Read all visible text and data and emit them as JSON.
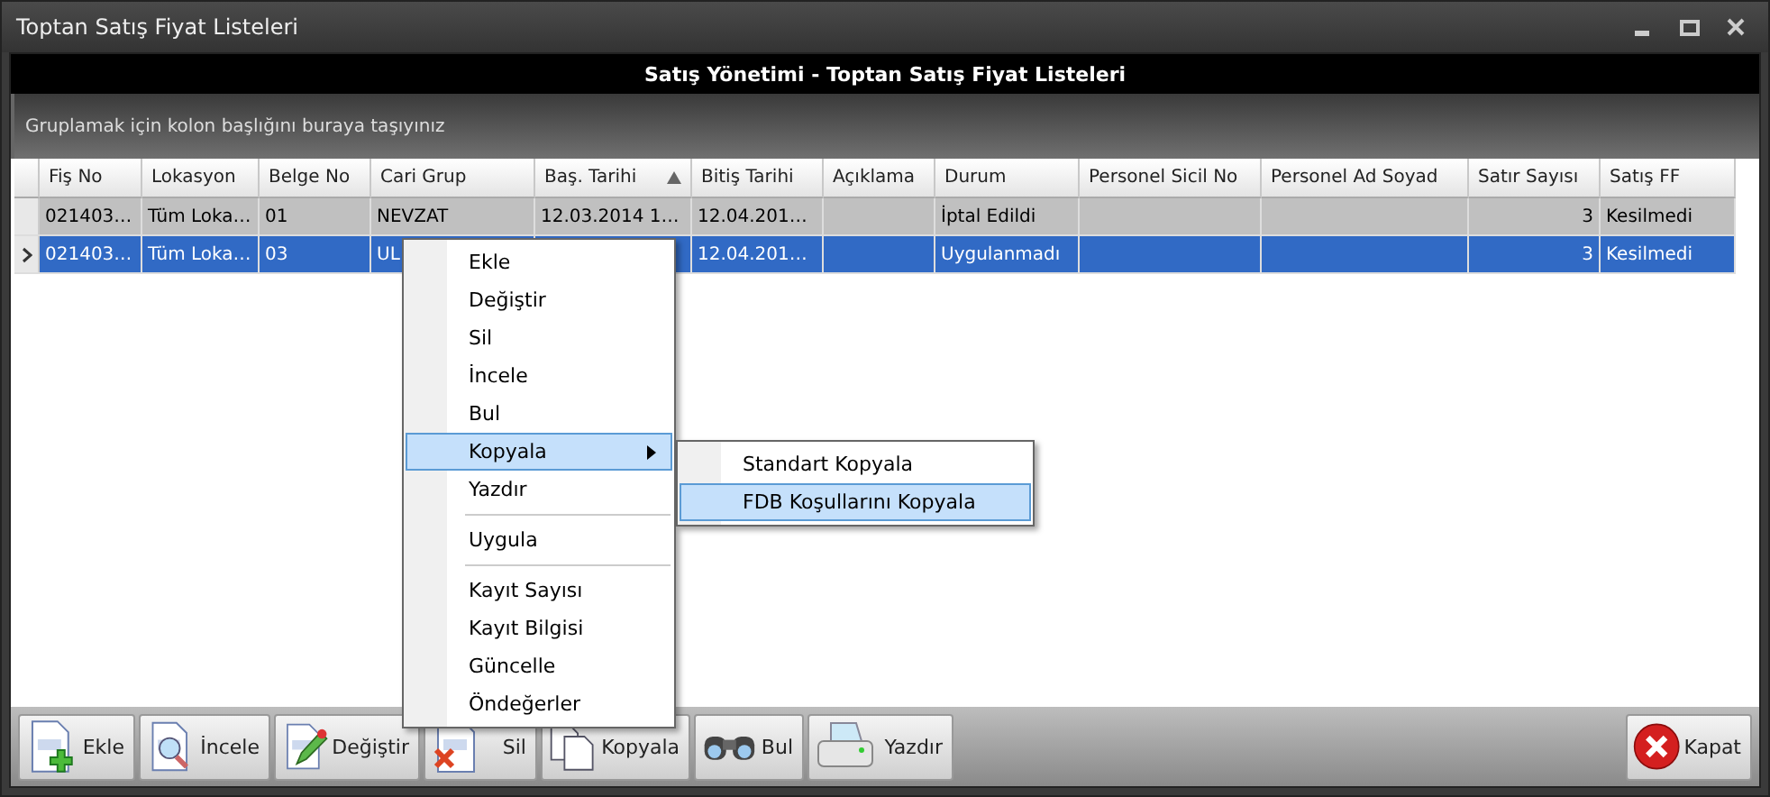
{
  "window": {
    "title": "Toptan Satış Fiyat Listeleri"
  },
  "header": {
    "title": "Satış Yönetimi - Toptan Satış Fiyat Listeleri"
  },
  "group_panel": {
    "hint": "Gruplamak için kolon başlığını buraya taşıyınız"
  },
  "table": {
    "columns": [
      {
        "label": "Fiş No",
        "sorted": false
      },
      {
        "label": "Lokasyon",
        "sorted": false
      },
      {
        "label": "Belge No",
        "sorted": false
      },
      {
        "label": "Cari Grup",
        "sorted": false
      },
      {
        "label": "Baş. Tarihi",
        "sorted": true
      },
      {
        "label": "Bitiş Tarihi",
        "sorted": false
      },
      {
        "label": "Açıklama",
        "sorted": false
      },
      {
        "label": "Durum",
        "sorted": false
      },
      {
        "label": "Personel Sicil No",
        "sorted": false
      },
      {
        "label": "Personel Ad Soyad",
        "sorted": false
      },
      {
        "label": "Satır Sayısı",
        "sorted": false
      },
      {
        "label": "Satış FF",
        "sorted": false
      }
    ],
    "rows": [
      {
        "selected": false,
        "cells": [
          "021403…",
          "Tüm Loka…",
          "01",
          "NEVZAT",
          "12.03.2014 1…",
          "12.04.201…",
          null,
          "İptal Edildi",
          null,
          null,
          "3",
          "Kesilmedi"
        ]
      },
      {
        "selected": true,
        "cells": [
          "021403…",
          "Tüm Loka…",
          "03",
          "UL",
          null,
          "12.04.201…",
          null,
          "Uygulanmadı",
          null,
          null,
          "3",
          "Kesilmedi"
        ]
      }
    ]
  },
  "context_menu": {
    "items": [
      {
        "kind": "item",
        "label": "Ekle",
        "selected": false,
        "has_submenu": false
      },
      {
        "kind": "item",
        "label": "Değiştir",
        "selected": false,
        "has_submenu": false
      },
      {
        "kind": "item",
        "label": "Sil",
        "selected": false,
        "has_submenu": false
      },
      {
        "kind": "item",
        "label": "İncele",
        "selected": false,
        "has_submenu": false
      },
      {
        "kind": "item",
        "label": "Bul",
        "selected": false,
        "has_submenu": false
      },
      {
        "kind": "item",
        "label": "Kopyala",
        "selected": true,
        "has_submenu": true
      },
      {
        "kind": "item",
        "label": "Yazdır",
        "selected": false,
        "has_submenu": false
      },
      {
        "kind": "separator"
      },
      {
        "kind": "item",
        "label": "Uygula",
        "selected": false,
        "has_submenu": false
      },
      {
        "kind": "separator"
      },
      {
        "kind": "item",
        "label": "Kayıt Sayısı",
        "selected": false,
        "has_submenu": false
      },
      {
        "kind": "item",
        "label": "Kayıt Bilgisi",
        "selected": false,
        "has_submenu": false
      },
      {
        "kind": "item",
        "label": "Güncelle",
        "selected": false,
        "has_submenu": false
      },
      {
        "kind": "item",
        "label": "Öndeğerler",
        "selected": false,
        "has_submenu": false
      }
    ],
    "submenu": [
      {
        "label": "Standart Kopyala",
        "selected": false
      },
      {
        "label": "FDB Koşullarını Kopyala",
        "selected": true
      }
    ]
  },
  "toolbar": {
    "buttons": [
      {
        "label": "Ekle",
        "kind": "add"
      },
      {
        "label": "İncele",
        "kind": "inspect"
      },
      {
        "label": "Değiştir",
        "kind": "edit"
      },
      {
        "label": "Sil",
        "kind": "delete"
      },
      {
        "label": "Kopyala",
        "kind": "copy"
      },
      {
        "label": "Bul",
        "kind": "find"
      },
      {
        "label": "Yazdır",
        "kind": "print"
      }
    ],
    "close_button": {
      "label": "Kapat"
    }
  }
}
